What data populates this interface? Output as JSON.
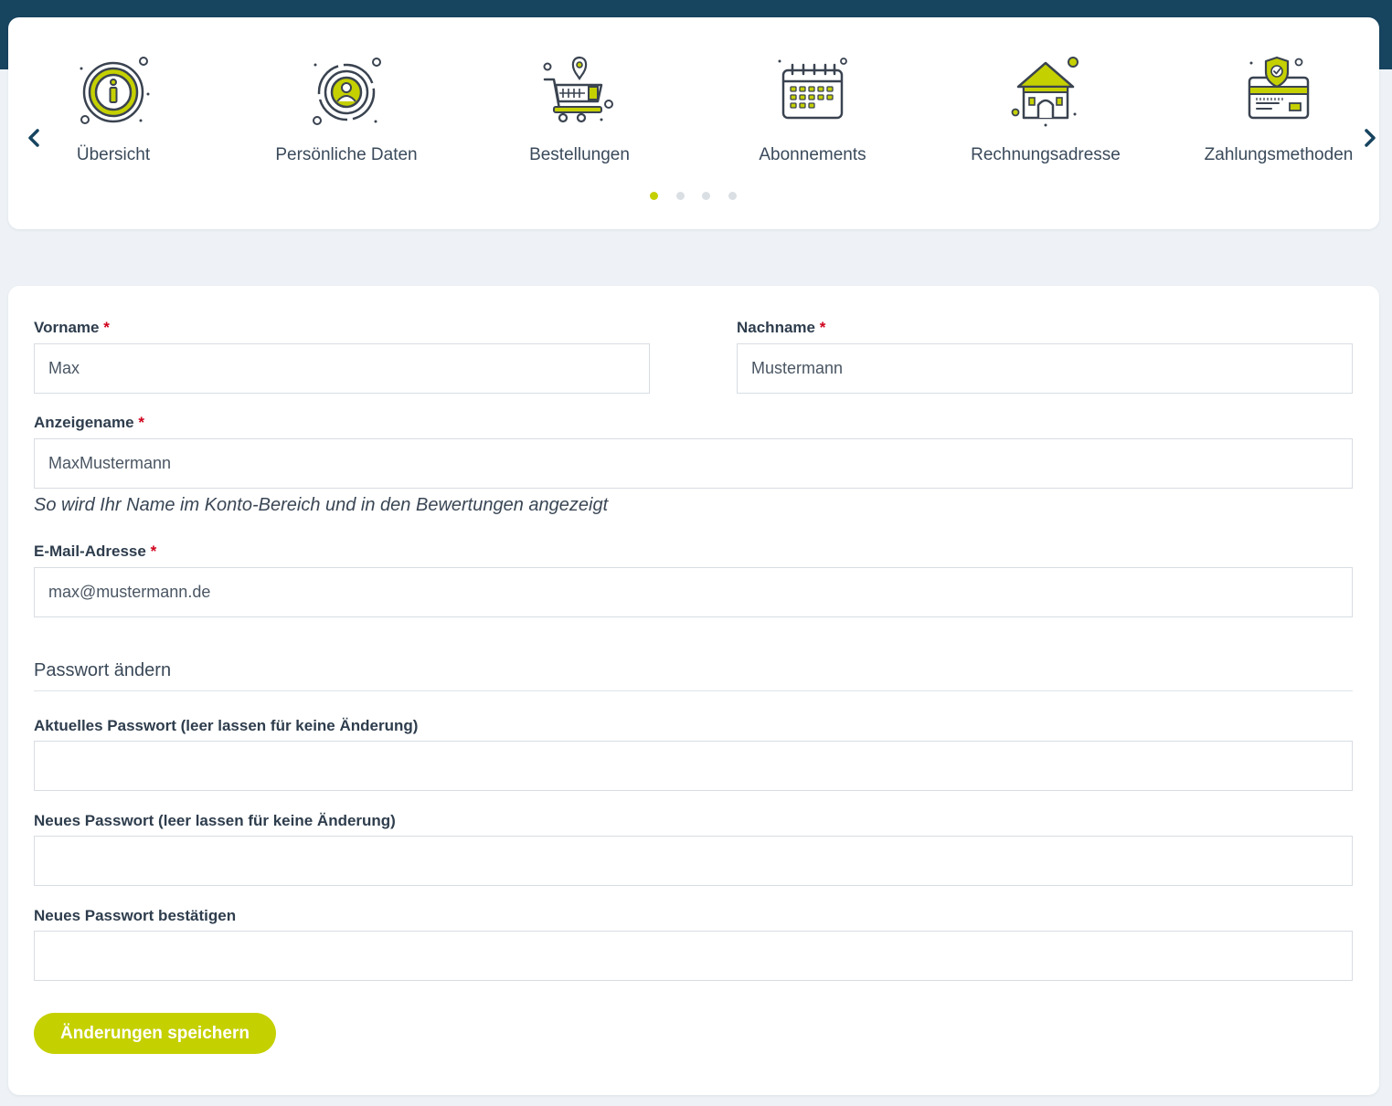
{
  "colors": {
    "accent": "#c5d000",
    "header": "#17445f",
    "background": "#eef2f6",
    "required_marker": "#d0021b",
    "dot_inactive": "#dadfe4"
  },
  "nav": {
    "prev_icon": "chevron-left-icon",
    "next_icon": "chevron-right-icon",
    "items": [
      {
        "label": "Übersicht",
        "icon": "info-icon"
      },
      {
        "label": "Persönliche Daten",
        "icon": "user-target-icon"
      },
      {
        "label": "Bestellungen",
        "icon": "shopping-cart-icon"
      },
      {
        "label": "Abonnements",
        "icon": "calendar-icon"
      },
      {
        "label": "Rechnungsadresse",
        "icon": "house-icon"
      },
      {
        "label": "Zahlungsmethoden",
        "icon": "credit-card-shield-icon"
      }
    ],
    "pagination": {
      "total": 4,
      "active": 1
    }
  },
  "form": {
    "required_marker": "*",
    "first_name": {
      "label": "Vorname",
      "value": "Max"
    },
    "last_name": {
      "label": "Nachname",
      "value": "Mustermann"
    },
    "display_name": {
      "label": "Anzeigename",
      "value": "MaxMustermann",
      "hint": "So wird Ihr Name im Konto-Bereich und in den Bewertungen angezeigt"
    },
    "email": {
      "label": "E-Mail-Adresse",
      "value": "max@mustermann.de"
    },
    "password_section": {
      "title": "Passwort ändern",
      "current": {
        "label": "Aktuelles Passwort (leer lassen für keine Änderung)",
        "value": ""
      },
      "new": {
        "label": "Neues Passwort (leer lassen für keine Änderung)",
        "value": ""
      },
      "confirm": {
        "label": "Neues Passwort bestätigen",
        "value": ""
      }
    },
    "save_label": "Änderungen speichern"
  }
}
